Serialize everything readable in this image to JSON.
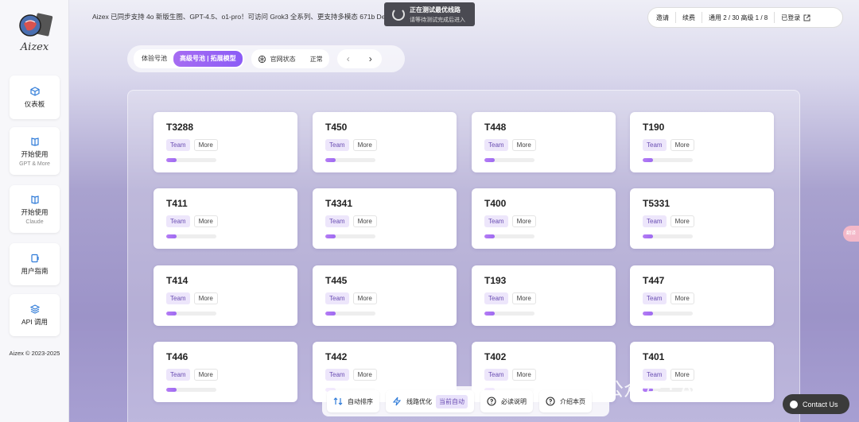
{
  "sidebar": {
    "logo_text": "Aizex",
    "items": [
      {
        "label": "仪表板",
        "sub": ""
      },
      {
        "label": "开始使用",
        "sub": "GPT & More"
      },
      {
        "label": "开始使用",
        "sub": "Claude"
      },
      {
        "label": "用户指南",
        "sub": ""
      },
      {
        "label": "API 调用",
        "sub": ""
      }
    ],
    "copyright": "Aizex © 2023-2025"
  },
  "announcement": "Aizex 已同步支持 4o 新版生图、GPT-4.5、o1-pro！可访问 Grok3 全系列、更支持多模态 671b DeepSeek",
  "toast": {
    "title": "正在测试最优线路",
    "subtitle": "请等待测试完成后进入"
  },
  "topright": {
    "invite": "邀请",
    "renew": "续费",
    "usage": "通用 2 / 30  高级 1 / 8",
    "login": "已登录"
  },
  "toolbar": {
    "tab_trial": "体验号池",
    "tab_advanced": "高级号池 | 拓展模型",
    "status_label": "官网状态",
    "status_value": "正常",
    "prev": "‹",
    "next": "›"
  },
  "cards": [
    {
      "name": "T3288",
      "team": "Team",
      "more": "More",
      "usage": 0.2
    },
    {
      "name": "T450",
      "team": "Team",
      "more": "More",
      "usage": 0.2
    },
    {
      "name": "T448",
      "team": "Team",
      "more": "More",
      "usage": 0.2
    },
    {
      "name": "T190",
      "team": "Team",
      "more": "More",
      "usage": 0.2
    },
    {
      "name": "T411",
      "team": "Team",
      "more": "More",
      "usage": 0.2
    },
    {
      "name": "T4341",
      "team": "Team",
      "more": "More",
      "usage": 0.2
    },
    {
      "name": "T400",
      "team": "Team",
      "more": "More",
      "usage": 0.2
    },
    {
      "name": "T5331",
      "team": "Team",
      "more": "More",
      "usage": 0.2
    },
    {
      "name": "T414",
      "team": "Team",
      "more": "More",
      "usage": 0.2
    },
    {
      "name": "T445",
      "team": "Team",
      "more": "More",
      "usage": 0.2
    },
    {
      "name": "T193",
      "team": "Team",
      "more": "More",
      "usage": 0.2
    },
    {
      "name": "T447",
      "team": "Team",
      "more": "More",
      "usage": 0.2
    },
    {
      "name": "T446",
      "team": "Team",
      "more": "More",
      "usage": 0.2
    },
    {
      "name": "T442",
      "team": "Team",
      "more": "More",
      "usage": 0.2
    },
    {
      "name": "T402",
      "team": "Team",
      "more": "More",
      "usage": 0.2
    },
    {
      "name": "T401",
      "team": "Team",
      "more": "More",
      "usage": 0.2
    }
  ],
  "bottombar": {
    "sort": "自动排序",
    "route": "线路优化",
    "route_badge": "当前自动",
    "notice": "必读说明",
    "intro": "介绍本页"
  },
  "watermark": "公众号 · Ai 你知道",
  "contact": "Contact Us",
  "side_tab": "翻译",
  "colors": {
    "accent": "#8b5cf6",
    "team_tag_bg": "#ede6fb",
    "toast_bg": "#4a4a52"
  }
}
